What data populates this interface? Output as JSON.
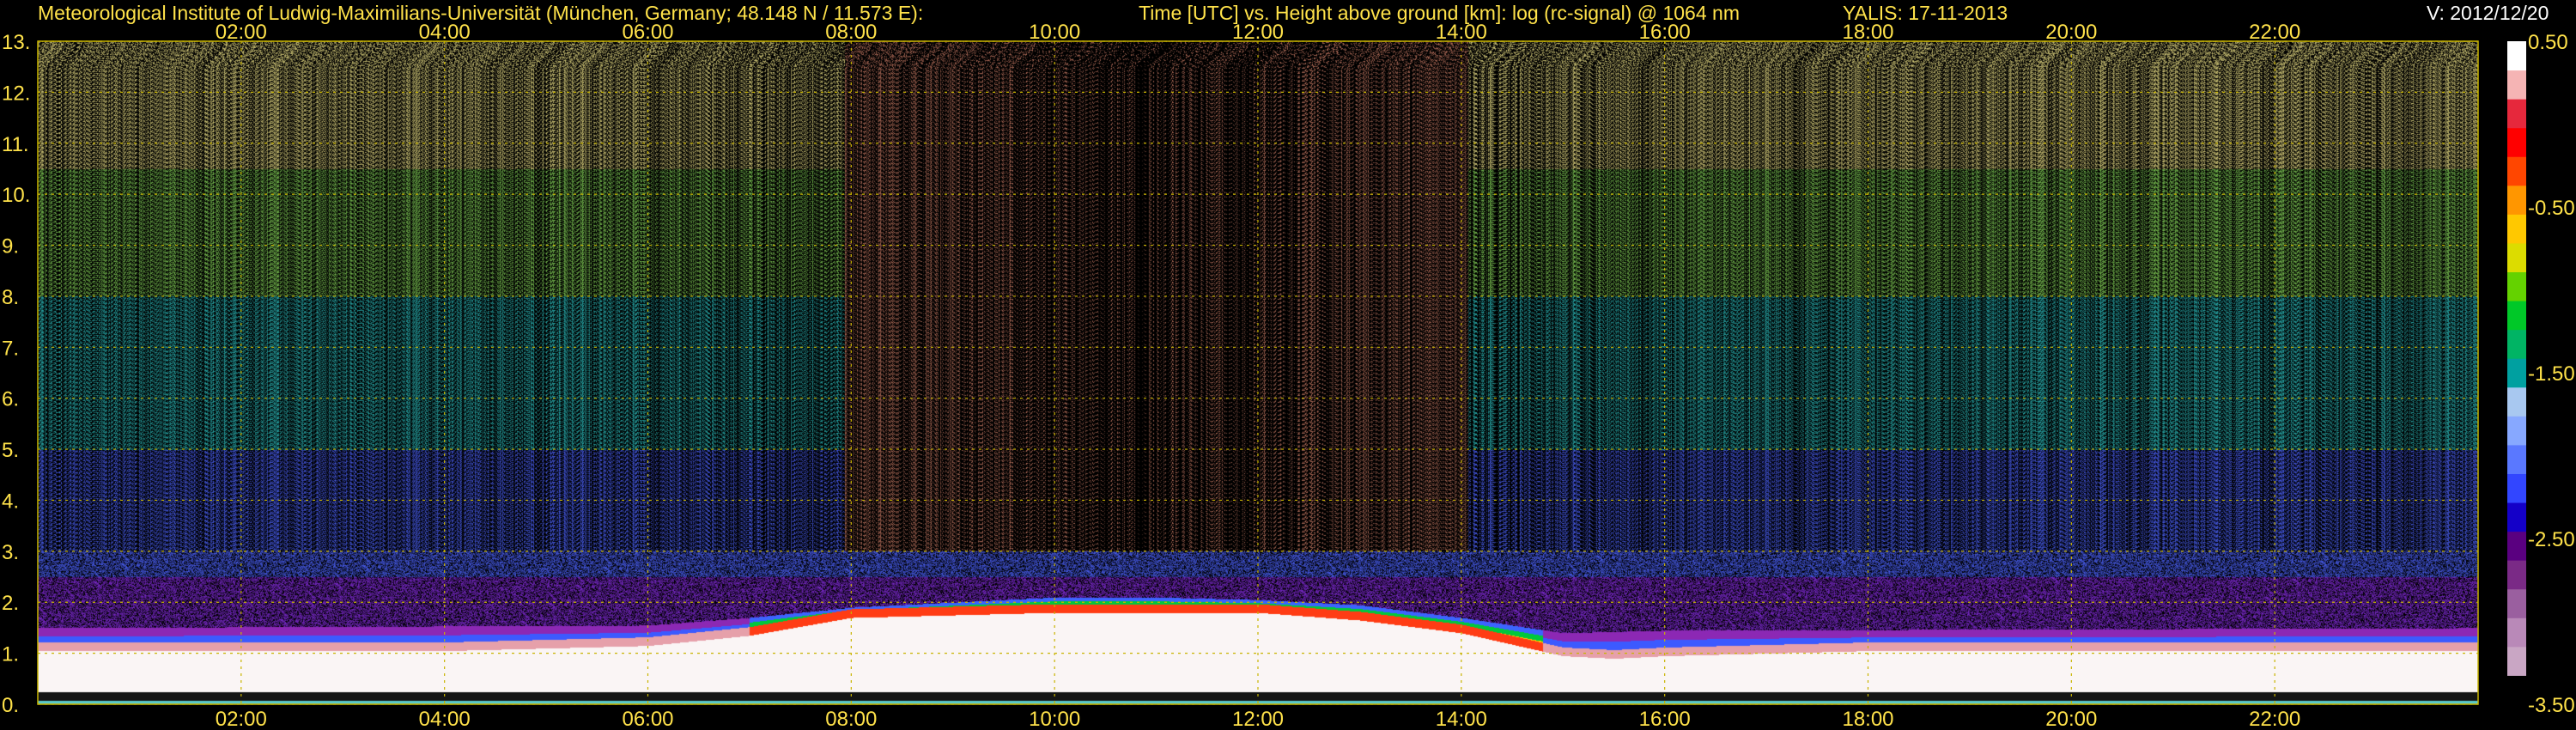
{
  "header": {
    "institute": "Meteorological Institute of Ludwig-Maximilians-Universität (München, Germany; 48.148 N / 11.573 E):",
    "description": "Time [UTC] vs. Height above ground [km]: log (rc-signal) @ 1064 nm",
    "instrument": "YALIS: 17-11-2013",
    "version": "V: 2012/12/20"
  },
  "colors": {
    "text": "#ffe24a",
    "version_text": "#ffffff",
    "grid": "#c8b400",
    "background": "#000000"
  },
  "chart_data": {
    "type": "heatmap",
    "title": "",
    "xlabel": "",
    "ylabel": "",
    "x_unit": "hours UTC",
    "xlim": [
      0,
      24
    ],
    "ylim": [
      0,
      13
    ],
    "x_ticks": [
      2,
      4,
      6,
      8,
      10,
      12,
      14,
      16,
      18,
      20,
      22
    ],
    "x_tick_labels": [
      "02:00",
      "04:00",
      "06:00",
      "08:00",
      "10:00",
      "12:00",
      "14:00",
      "16:00",
      "18:00",
      "20:00",
      "22:00"
    ],
    "y_ticks": [
      0,
      1,
      2,
      3,
      4,
      5,
      6,
      7,
      8,
      9,
      10,
      11,
      12,
      13
    ],
    "y_tick_labels": [
      "0.",
      "1.",
      "2.",
      "3.",
      "4.",
      "5.",
      "6.",
      "7.",
      "8.",
      "9.",
      "10.",
      "11.",
      "12.",
      "13."
    ],
    "grid": true,
    "colorbar": {
      "range": [
        -3.5,
        0.5
      ],
      "ticks": [
        0.5,
        -0.5,
        -1.5,
        -2.5,
        -3.5
      ],
      "tick_labels": [
        "0.50",
        "-0.50",
        "-1.50",
        "-2.50",
        "-3.50"
      ],
      "colors": [
        "#000000",
        "#c9a6c4",
        "#b989b8",
        "#9a5f9f",
        "#7a2a86",
        "#5a0080",
        "#1400c8",
        "#3246ff",
        "#5a78ff",
        "#87a8ff",
        "#a8c8f0",
        "#00a0a0",
        "#00b464",
        "#00c828",
        "#64d200",
        "#dcdc00",
        "#ffc800",
        "#ff9600",
        "#ff4600",
        "#ff0000",
        "#e6283c",
        "#f5b4b4",
        "#ffffff"
      ]
    },
    "boundary_layer_top_km": {
      "time_h": [
        0,
        2,
        4,
        6,
        7,
        8,
        9,
        10,
        11,
        12,
        13,
        14,
        15,
        15.5,
        16,
        18,
        20,
        22,
        24
      ],
      "height_km": [
        1.1,
        1.1,
        1.1,
        1.2,
        1.4,
        1.75,
        1.8,
        1.85,
        1.85,
        1.85,
        1.7,
        1.45,
        1.0,
        0.95,
        1.0,
        1.1,
        1.1,
        1.1,
        1.1
      ]
    },
    "elevated_layer_top_km": {
      "time_h": [
        0,
        6,
        7,
        8,
        9,
        10,
        11,
        12,
        13,
        14,
        15,
        16,
        24
      ],
      "height_km": [
        1.5,
        1.55,
        1.7,
        1.9,
        2.0,
        2.1,
        2.1,
        2.05,
        1.95,
        1.7,
        1.4,
        1.45,
        1.5
      ]
    }
  }
}
